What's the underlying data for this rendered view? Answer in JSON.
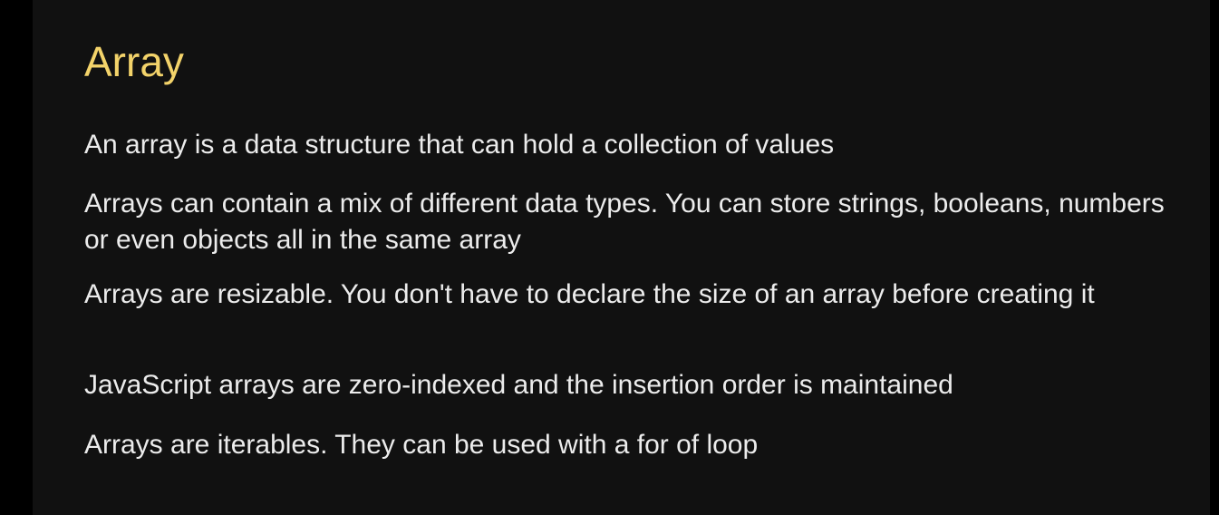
{
  "slide": {
    "title": "Array",
    "title_color": "#f3d36a",
    "background": "#111111",
    "bullets": [
      "An array is a data structure that can hold a collection of values",
      "Arrays can contain a mix of different data types. You can store strings, booleans, numbers or even objects all in the same array",
      "Arrays are resizable. You don't have to declare the size of an array before creating it",
      "JavaScript arrays are zero-indexed and the insertion order is maintained",
      "Arrays are iterables. They can be used with a for of loop"
    ]
  }
}
